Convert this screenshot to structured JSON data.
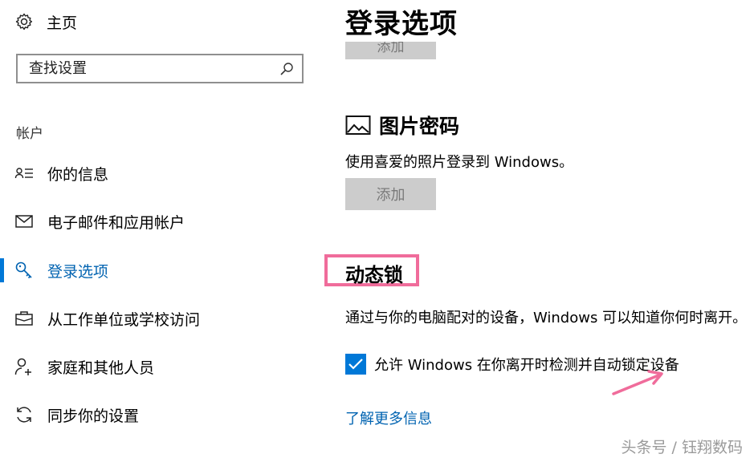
{
  "sidebar": {
    "home_label": "主页",
    "search_placeholder": "查找设置",
    "section_title": "帐户",
    "items": [
      {
        "label": "你的信息",
        "icon": "user-info-icon"
      },
      {
        "label": "电子邮件和应用帐户",
        "icon": "mail-icon"
      },
      {
        "label": "登录选项",
        "icon": "key-icon",
        "active": true
      },
      {
        "label": "从工作单位或学校访问",
        "icon": "briefcase-icon"
      },
      {
        "label": "家庭和其他人员",
        "icon": "person-add-icon"
      },
      {
        "label": "同步你的设置",
        "icon": "sync-icon"
      }
    ]
  },
  "main": {
    "title": "登录选项",
    "top_button_label": "添加",
    "picture_password": {
      "title": "图片密码",
      "description": "使用喜爱的照片登录到 Windows。",
      "add_button": "添加"
    },
    "dynamic_lock": {
      "title": "动态锁",
      "description": "通过与你的电脑配对的设备，Windows 可以知道你何时离开。",
      "checkbox_label": "允许 Windows 在你离开时检测并自动锁定设备",
      "checked": true,
      "link": "了解更多信息"
    }
  },
  "watermark": "头条号 / 钰翔数码",
  "colors": {
    "accent": "#0078d7",
    "highlight": "#f06c9b",
    "link": "#0063b1",
    "disabled_button": "#cccccc"
  }
}
